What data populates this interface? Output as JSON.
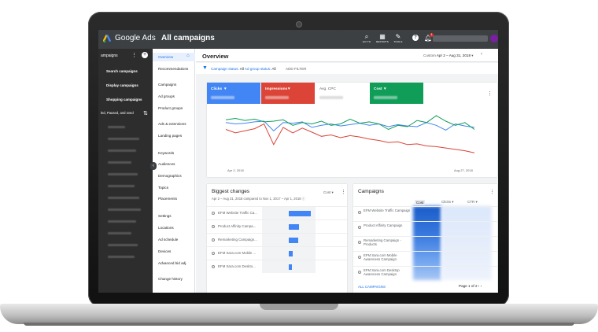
{
  "topbar": {
    "brand": "Google Ads",
    "page_title": "All campaigns",
    "tools": [
      {
        "icon": "search-icon",
        "glyph": "⌕",
        "label": "GO TO"
      },
      {
        "icon": "reports-icon",
        "glyph": "▦",
        "label": "REPORTS"
      },
      {
        "icon": "wrench-icon",
        "glyph": "✎",
        "label": "TOOLS"
      }
    ],
    "help_glyph": "?",
    "notifications_count": "1"
  },
  "leftnav": {
    "header": "ampaigns",
    "items": [
      "Search campaigns",
      "Display campaigns",
      "Shopping campaigns"
    ],
    "filter_text": "led, Paused, and oved"
  },
  "pagemenu": {
    "items": [
      {
        "label": "Overview",
        "active": true
      },
      {
        "label": "Recommendations"
      },
      {
        "label": "Campaigns"
      },
      {
        "label": "Ad groups"
      },
      {
        "label": "Product groups"
      },
      {
        "label": "Ads & extensions"
      },
      {
        "label": "Landing pages"
      },
      {
        "label": "Keywords"
      },
      {
        "label": "Audiences"
      },
      {
        "label": "Demographics"
      },
      {
        "label": "Topics"
      },
      {
        "label": "Placements"
      },
      {
        "label": "Settings"
      },
      {
        "label": "Locations"
      },
      {
        "label": "Ad schedule"
      },
      {
        "label": "Devices"
      },
      {
        "label": "Advanced bid adj."
      },
      {
        "label": "Change history"
      }
    ]
  },
  "overview": {
    "title": "Overview",
    "date_prefix": "Custom",
    "date_range": "Apr 2 – Aug 31, 2018",
    "filter_label": "Campaign status:",
    "filter_value1": "All",
    "filter_label2": "Ad group status:",
    "filter_value2": "All",
    "add_filter": "ADD FILTER"
  },
  "metrics": [
    {
      "label": "Clicks",
      "color": "#4285f4",
      "dropdown": true
    },
    {
      "label": "Impressions",
      "color": "#db4437",
      "dropdown": true
    },
    {
      "label": "Avg. CPC",
      "color": "#ffffff",
      "dropdown": false
    },
    {
      "label": "Cost",
      "color": "#0f9d58",
      "dropdown": true
    }
  ],
  "chart_data": {
    "type": "line",
    "x_start_label": "Apr 2, 2018",
    "x_end_label": "Aug 27, 2018",
    "series": [
      {
        "name": "Clicks",
        "color": "#4285f4",
        "values": [
          62,
          60,
          61,
          63,
          64,
          50,
          62,
          61,
          63,
          55,
          58,
          60,
          57,
          59,
          61,
          58,
          60,
          56,
          59,
          57,
          56,
          62,
          58,
          51,
          60,
          57,
          55
        ]
      },
      {
        "name": "Impressions",
        "color": "#db4437",
        "values": [
          52,
          47,
          50,
          53,
          60,
          30,
          55,
          47,
          54,
          48,
          42,
          44,
          40,
          43,
          41,
          38,
          36,
          33,
          34,
          30,
          31,
          28,
          27,
          25,
          23,
          21,
          18
        ]
      },
      {
        "name": "Cost",
        "color": "#0f9d58",
        "values": [
          66,
          68,
          65,
          67,
          63,
          64,
          66,
          58,
          62,
          60,
          64,
          58,
          60,
          67,
          61,
          63,
          60,
          52,
          58,
          56,
          65,
          62,
          72,
          64,
          58,
          62,
          52
        ]
      }
    ]
  },
  "biggest_changes": {
    "title": "Biggest changes",
    "subtitle": "Apr 2 – Aug 31, 2018 compared to Nov 1, 2017 – Apr 1, 2018",
    "metric": "Cost",
    "rows": [
      {
        "label": "EFM Website Traffic Ca...",
        "value": 0.88
      },
      {
        "label": "Product Affinity Campa...",
        "value": 0.42
      },
      {
        "label": "Remarketing Campaign...",
        "value": 0.38
      },
      {
        "label": "EFM Sara.com Mobile ...",
        "value": 0.14
      },
      {
        "label": "EFM Sara.com Deskto...",
        "value": 0.12
      }
    ]
  },
  "campaigns": {
    "title": "Campaigns",
    "columns": [
      "Cost",
      "Clicks",
      "CTR"
    ],
    "rows": [
      "EFM Website Traffic Campaign",
      "Product Affinity Campaign",
      "Remarketing Campaign - Products",
      "EFM Sara.com Mobile Awareness Campaign",
      "EFM Sara.com Desktop Awareness Campaign"
    ],
    "all_link": "ALL CAMPAIGNS",
    "pager": "Page 1 of 2"
  }
}
